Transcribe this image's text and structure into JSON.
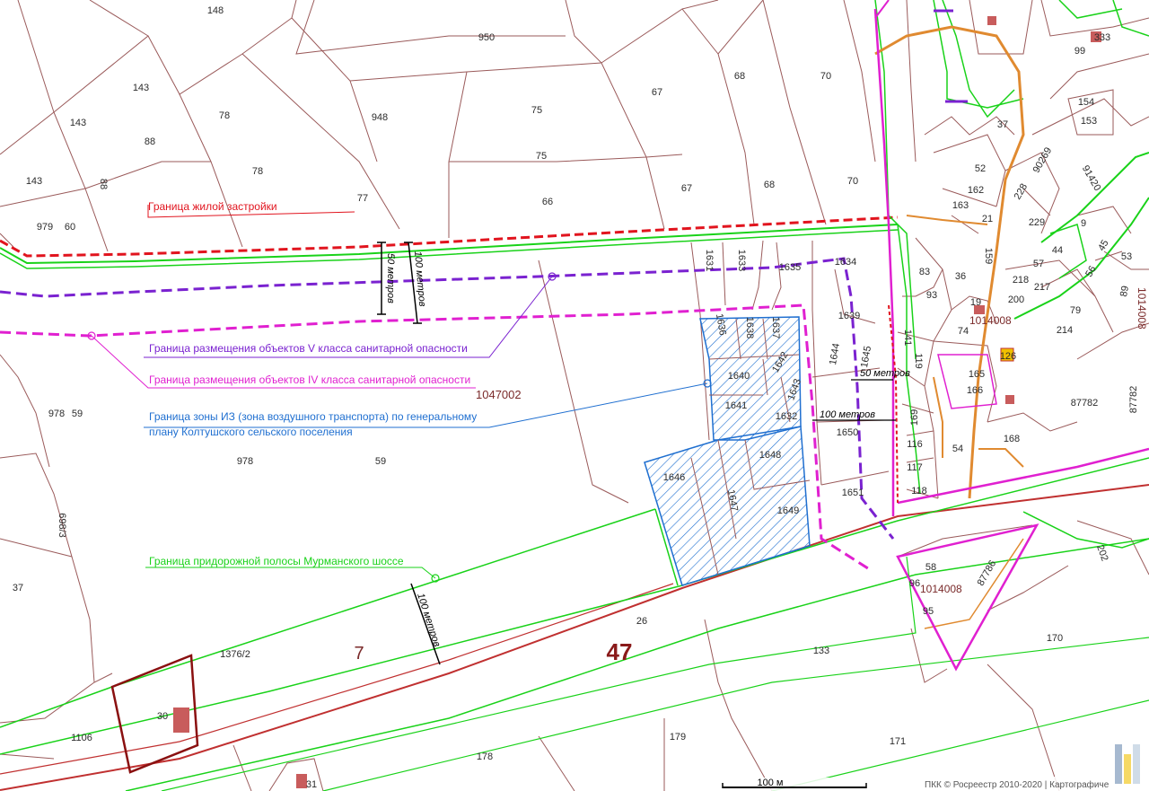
{
  "colors": {
    "residential": "#e1141e",
    "class5": "#7a22d0",
    "class4": "#e020d0",
    "airzone": "#1f6fd0",
    "roadside": "#19d219",
    "parcel": "#9a5a5a",
    "road": "#c03030",
    "orange": "#e08a30"
  },
  "legend": {
    "residential": "Граница жилой застройки",
    "class5": "Граница размещения объектов V класса санитарной опасности",
    "class4": "Граница размещения объектов IV класса санитарной опасности",
    "airzone_line1": "Граница зоны ИЗ (зона воздушного транспорта) по генеральному",
    "airzone_line2": "плану Колтушского сельского поселения",
    "roadside": "Граница придорожной полосы Мурманского шоссе"
  },
  "distances": {
    "d50_vertical": "50 метров",
    "d100_vertical": "100 метров",
    "d50_right": "50 метров",
    "d100_right": "100 метров",
    "d100_road": "100 метров"
  },
  "quarters": {
    "q1": "1047002",
    "q2": "1014008",
    "q3": "1014008",
    "q4": "1014008"
  },
  "big_labels": {
    "seven": "7",
    "road": "47"
  },
  "parcel_labels": [
    "148",
    "950",
    "143",
    "143",
    "78",
    "948",
    "75",
    "75",
    "68",
    "68",
    "67",
    "67",
    "70",
    "70",
    "88",
    "88",
    "78",
    "77",
    "66",
    "143",
    "979",
    "60",
    "37",
    "52",
    "162",
    "163",
    "21",
    "228",
    "229",
    "90269",
    "91420",
    "99",
    "333",
    "154",
    "153",
    "9",
    "1631",
    "1633",
    "1635",
    "1634",
    "1639",
    "1636",
    "1638",
    "1637",
    "1640",
    "1642",
    "1643",
    "1644",
    "1645",
    "1641",
    "1632",
    "1650",
    "1651",
    "1646",
    "1647",
    "1648",
    "1649",
    "83",
    "36",
    "93",
    "19",
    "159",
    "74",
    "141",
    "119",
    "126",
    "165",
    "166",
    "57",
    "218",
    "217",
    "200",
    "79",
    "214",
    "56",
    "53",
    "89",
    "44",
    "45",
    "978",
    "59",
    "978",
    "59",
    "37",
    "698/3",
    "169",
    "116",
    "117",
    "118",
    "54",
    "168",
    "87782",
    "87782",
    "58",
    "96",
    "95",
    "87786",
    "170",
    "26",
    "133",
    "1376/2",
    "30",
    "1106",
    "178",
    "179",
    "171",
    "31",
    "202"
  ],
  "footer": {
    "scale": "100 м",
    "copyright": "ПКК © Росреестр 2010-2020 | Картографиче"
  }
}
